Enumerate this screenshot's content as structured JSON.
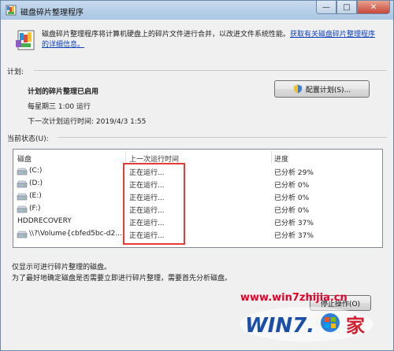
{
  "window": {
    "title": "磁盘碎片整理程序",
    "controls": {
      "minimize": "—",
      "maximize": "□",
      "close": "✕"
    }
  },
  "intro": {
    "text": "磁盘碎片整理程序将计算机硬盘上的碎片文件进行合并，以改进文件系统性能。",
    "link": "获取有关磁盘碎片整理程序的详细信息。"
  },
  "schedule": {
    "section_label": "计划:",
    "status": "计划的碎片整理已启用",
    "frequency": "每星期三  1:00 运行",
    "next_run": "下一次计划运行时间: 2019/4/3 1:55",
    "configure_button": "配置计划(S)..."
  },
  "current_status": {
    "section_label": "当前状态(U):",
    "columns": [
      "磁盘",
      "上一次运行时间",
      "进度"
    ],
    "rows": [
      {
        "disk": "(C:)",
        "last_run": "正在运行...",
        "progress": "已分析 29%"
      },
      {
        "disk": "(D:)",
        "last_run": "正在运行...",
        "progress": "已分析 0%"
      },
      {
        "disk": "(E:)",
        "last_run": "正在运行...",
        "progress": "已分析 0%"
      },
      {
        "disk": "(F:)",
        "last_run": "正在运行...",
        "progress": "已分析 0%"
      },
      {
        "disk": "HDDRECOVERY",
        "last_run": "正在运行...",
        "progress": "已分析 37%"
      },
      {
        "disk": "\\\\?\\Volume{cbfed5bc-d2...",
        "last_run": "正在运行...",
        "progress": "已分析 37%"
      }
    ]
  },
  "notes": {
    "line1": "仅显示可进行碎片整理的磁盘。",
    "line2": "为了最好地确定磁盘是否需要立即进行碎片整理，需要首先分析磁盘。"
  },
  "buttons": {
    "stop": "停止操作(O)"
  },
  "watermark": {
    "url": "www.win7zhijia.cn",
    "logo": "WIN7.家"
  },
  "colors": {
    "highlight_box": "#e53b3b",
    "link": "#0f42b8",
    "watermark": "#e0002a"
  }
}
